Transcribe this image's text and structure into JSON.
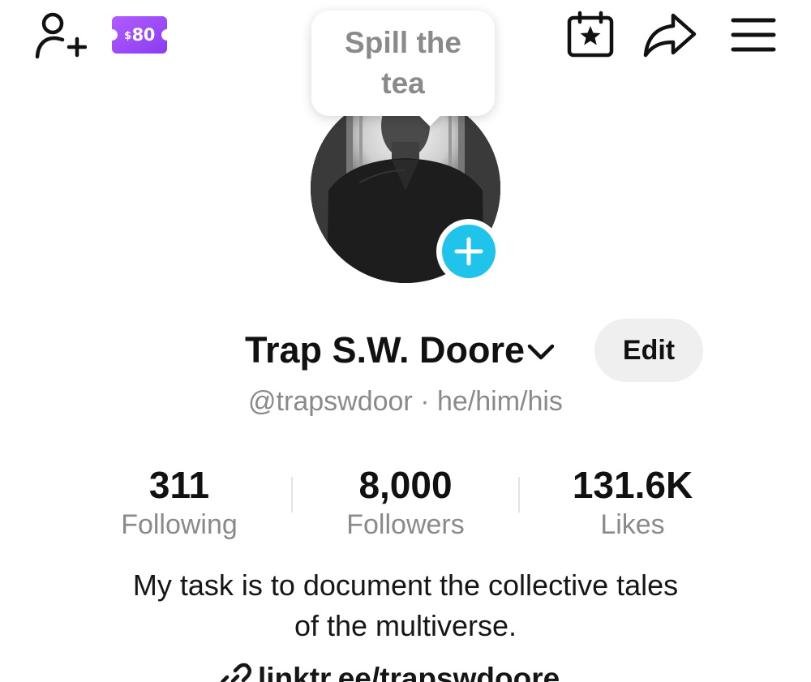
{
  "header": {
    "coupon": {
      "currency": "$",
      "amount": "80",
      "color": "#9b4dff"
    },
    "icons": [
      "add-friend-icon",
      "coupon-icon",
      "calendar-star-icon",
      "share-icon",
      "menu-icon"
    ]
  },
  "tooltip": {
    "text": "Spill the tea"
  },
  "profile": {
    "display_name": "Trap S.W. Doore",
    "edit_label": "Edit",
    "handle_line": "@trapswdoor · he/him/his",
    "add_button_color": "#20c3ea"
  },
  "stats": [
    {
      "value": "311",
      "label": "Following"
    },
    {
      "value": "8,000",
      "label": "Followers"
    },
    {
      "value": "131.6K",
      "label": "Likes"
    }
  ],
  "bio": {
    "line1": "My task is to document the collective tales",
    "line2": "of the multiverse."
  },
  "link": {
    "text": "linktr.ee/trapswdoore"
  }
}
